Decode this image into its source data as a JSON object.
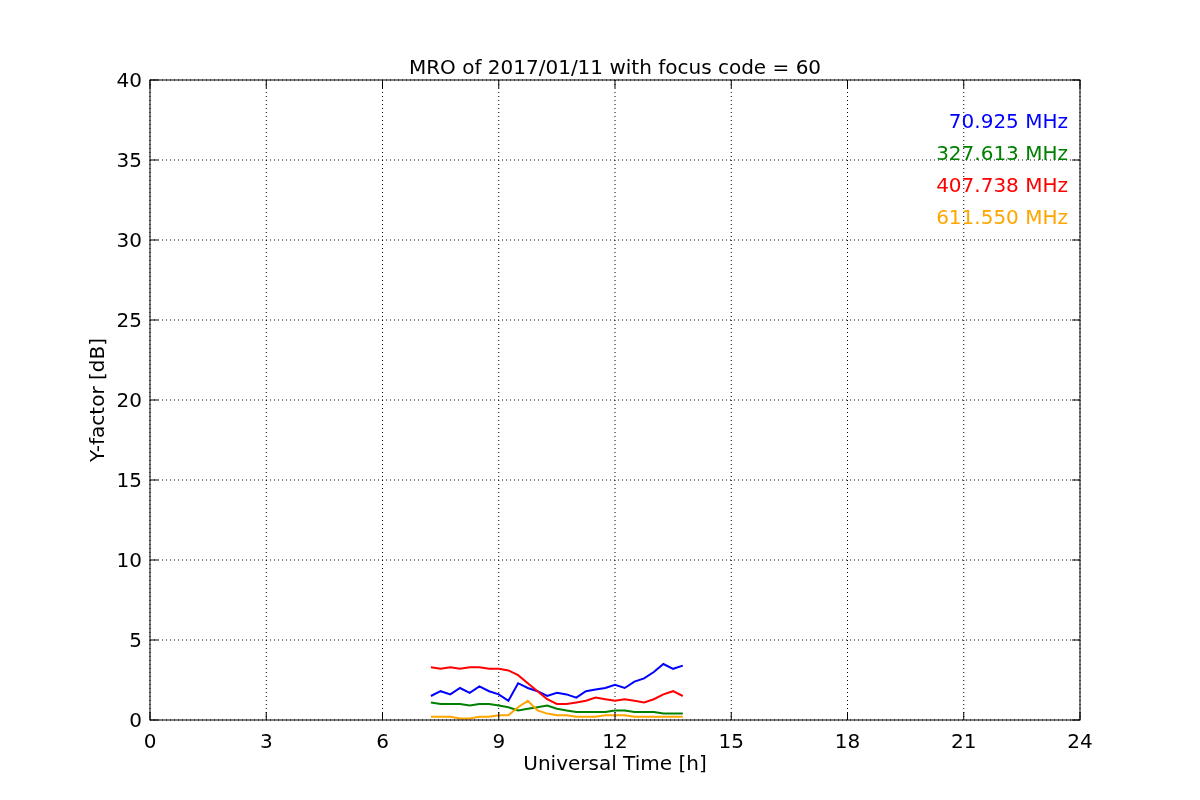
{
  "chart_data": {
    "type": "line",
    "title": "MRO of 2017/01/11 with focus code = 60",
    "xlabel": "Universal Time [h]",
    "ylabel": "Y-factor [dB]",
    "x": [
      7.25,
      7.5,
      7.75,
      8,
      8.25,
      8.5,
      8.75,
      9,
      9.25,
      9.5,
      9.75,
      10,
      10.25,
      10.5,
      10.75,
      11,
      11.25,
      11.5,
      11.75,
      12,
      12.25,
      12.5,
      12.75,
      13,
      13.25,
      13.5,
      13.75
    ],
    "series": [
      {
        "name": "70.925 MHz",
        "color": "#0000ff",
        "values": [
          1.5,
          1.8,
          1.6,
          2.0,
          1.7,
          2.1,
          1.8,
          1.6,
          1.2,
          2.3,
          2.0,
          1.8,
          1.5,
          1.7,
          1.6,
          1.4,
          1.8,
          1.9,
          2.0,
          2.2,
          2.0,
          2.4,
          2.6,
          3.0,
          3.5,
          3.2,
          3.4
        ]
      },
      {
        "name": "327.613 MHz",
        "color": "#008000",
        "values": [
          1.1,
          1.0,
          1.0,
          1.0,
          0.9,
          1.0,
          1.0,
          0.9,
          0.8,
          0.6,
          0.7,
          0.8,
          0.9,
          0.7,
          0.6,
          0.5,
          0.5,
          0.5,
          0.5,
          0.6,
          0.6,
          0.5,
          0.5,
          0.5,
          0.4,
          0.4,
          0.4
        ]
      },
      {
        "name": "407.738 MHz",
        "color": "#ff0000",
        "values": [
          3.3,
          3.2,
          3.3,
          3.2,
          3.3,
          3.3,
          3.2,
          3.2,
          3.1,
          2.8,
          2.3,
          1.8,
          1.3,
          1.0,
          1.0,
          1.1,
          1.2,
          1.4,
          1.3,
          1.2,
          1.3,
          1.2,
          1.1,
          1.3,
          1.6,
          1.8,
          1.5
        ]
      },
      {
        "name": "611.550 MHz",
        "color": "#ffa500",
        "values": [
          0.2,
          0.2,
          0.2,
          0.1,
          0.1,
          0.2,
          0.2,
          0.3,
          0.3,
          0.8,
          1.2,
          0.6,
          0.4,
          0.3,
          0.3,
          0.2,
          0.2,
          0.2,
          0.3,
          0.3,
          0.3,
          0.2,
          0.2,
          0.2,
          0.2,
          0.2,
          0.2
        ]
      }
    ],
    "xlim": [
      0,
      24
    ],
    "ylim": [
      0,
      40
    ],
    "grid": true,
    "xticks": [
      0,
      3,
      6,
      9,
      12,
      15,
      18,
      21,
      24
    ],
    "yticks": [
      0,
      5,
      10,
      15,
      20,
      25,
      30,
      35,
      40
    ]
  }
}
